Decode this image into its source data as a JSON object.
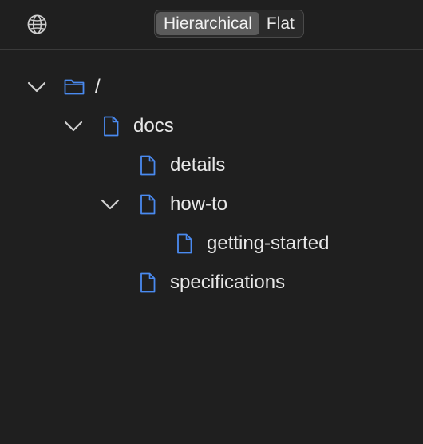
{
  "toolbar": {
    "globe_icon": "globe-icon",
    "view_modes": [
      {
        "label": "Hierarchical",
        "selected": true
      },
      {
        "label": "Flat",
        "selected": false
      }
    ]
  },
  "tree": {
    "accent_color": "#4a8af0",
    "nodes": [
      {
        "label": "/",
        "icon": "folder-icon",
        "expanded": true,
        "depth": 0
      },
      {
        "label": "docs",
        "icon": "document-icon",
        "expanded": true,
        "depth": 1
      },
      {
        "label": "details",
        "icon": "document-icon",
        "expanded": null,
        "depth": 2
      },
      {
        "label": "how-to",
        "icon": "document-icon",
        "expanded": true,
        "depth": 2
      },
      {
        "label": "getting-started",
        "icon": "document-icon",
        "expanded": null,
        "depth": 3
      },
      {
        "label": "specifications",
        "icon": "document-icon",
        "expanded": null,
        "depth": 2
      }
    ]
  }
}
